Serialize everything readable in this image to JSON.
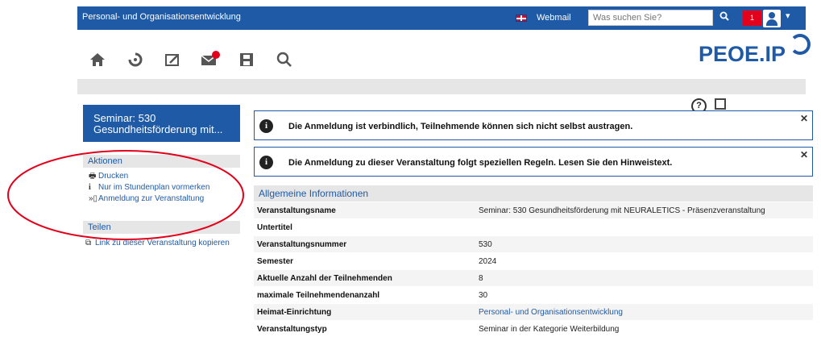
{
  "topbar": {
    "title": "Personal- und Organisationsentwicklung",
    "webmail": "Webmail",
    "search_placeholder": "Was suchen Sie?",
    "notification_count": "1",
    "brand_color": "#1f5aa6",
    "alert_color": "#e2001a"
  },
  "icons": {
    "nav": [
      "home-icon",
      "refresh-icon",
      "edit-icon",
      "mail-icon",
      "save-icon",
      "search-icon"
    ],
    "mail_badge": "1"
  },
  "logo": {
    "text_main": "PEOE",
    "text_dot": ".",
    "text_ip": "IP"
  },
  "sidebar": {
    "seminar_title_line1": "Seminar: 530",
    "seminar_title_line2": "Gesundheitsförderung mit...",
    "aktionen_header": "Aktionen",
    "aktionen": [
      {
        "icon": "printer-icon",
        "label": "Drucken"
      },
      {
        "icon": "info-icon",
        "label": "Nur im Stundenplan vormerken"
      },
      {
        "icon": "signin-icon",
        "label": "Anmeldung zur Veranstaltung"
      }
    ],
    "teilen_header": "Teilen",
    "teilen": [
      {
        "icon": "copy-link-icon",
        "label": "Link zu dieser Veranstaltung kopieren"
      }
    ]
  },
  "alerts": [
    {
      "text": "Die Anmeldung ist verbindlich, Teilnehmende können sich nicht selbst austragen."
    },
    {
      "text": "Die Anmeldung zu dieser Veranstaltung folgt speziellen Regeln. Lesen Sie den Hinweistext."
    }
  ],
  "info": {
    "header": "Allgemeine Informationen",
    "rows": [
      {
        "key": "Veranstaltungsname",
        "value": "Seminar: 530 Gesundheitsförderung mit NEURALETICS - Präsenzveranstaltung"
      },
      {
        "key": "Untertitel",
        "value": ""
      },
      {
        "key": "Veranstaltungsnummer",
        "value": "530"
      },
      {
        "key": "Semester",
        "value": "2024"
      },
      {
        "key": "Aktuelle Anzahl der Teilnehmenden",
        "value": "8"
      },
      {
        "key": "maximale Teilnehmendenanzahl",
        "value": "30"
      },
      {
        "key": "Heimat-Einrichtung",
        "value": "Personal- und Organisationsentwicklung"
      },
      {
        "key": "Veranstaltungstyp",
        "value": "Seminar in der Kategorie Weiterbildung"
      }
    ]
  }
}
